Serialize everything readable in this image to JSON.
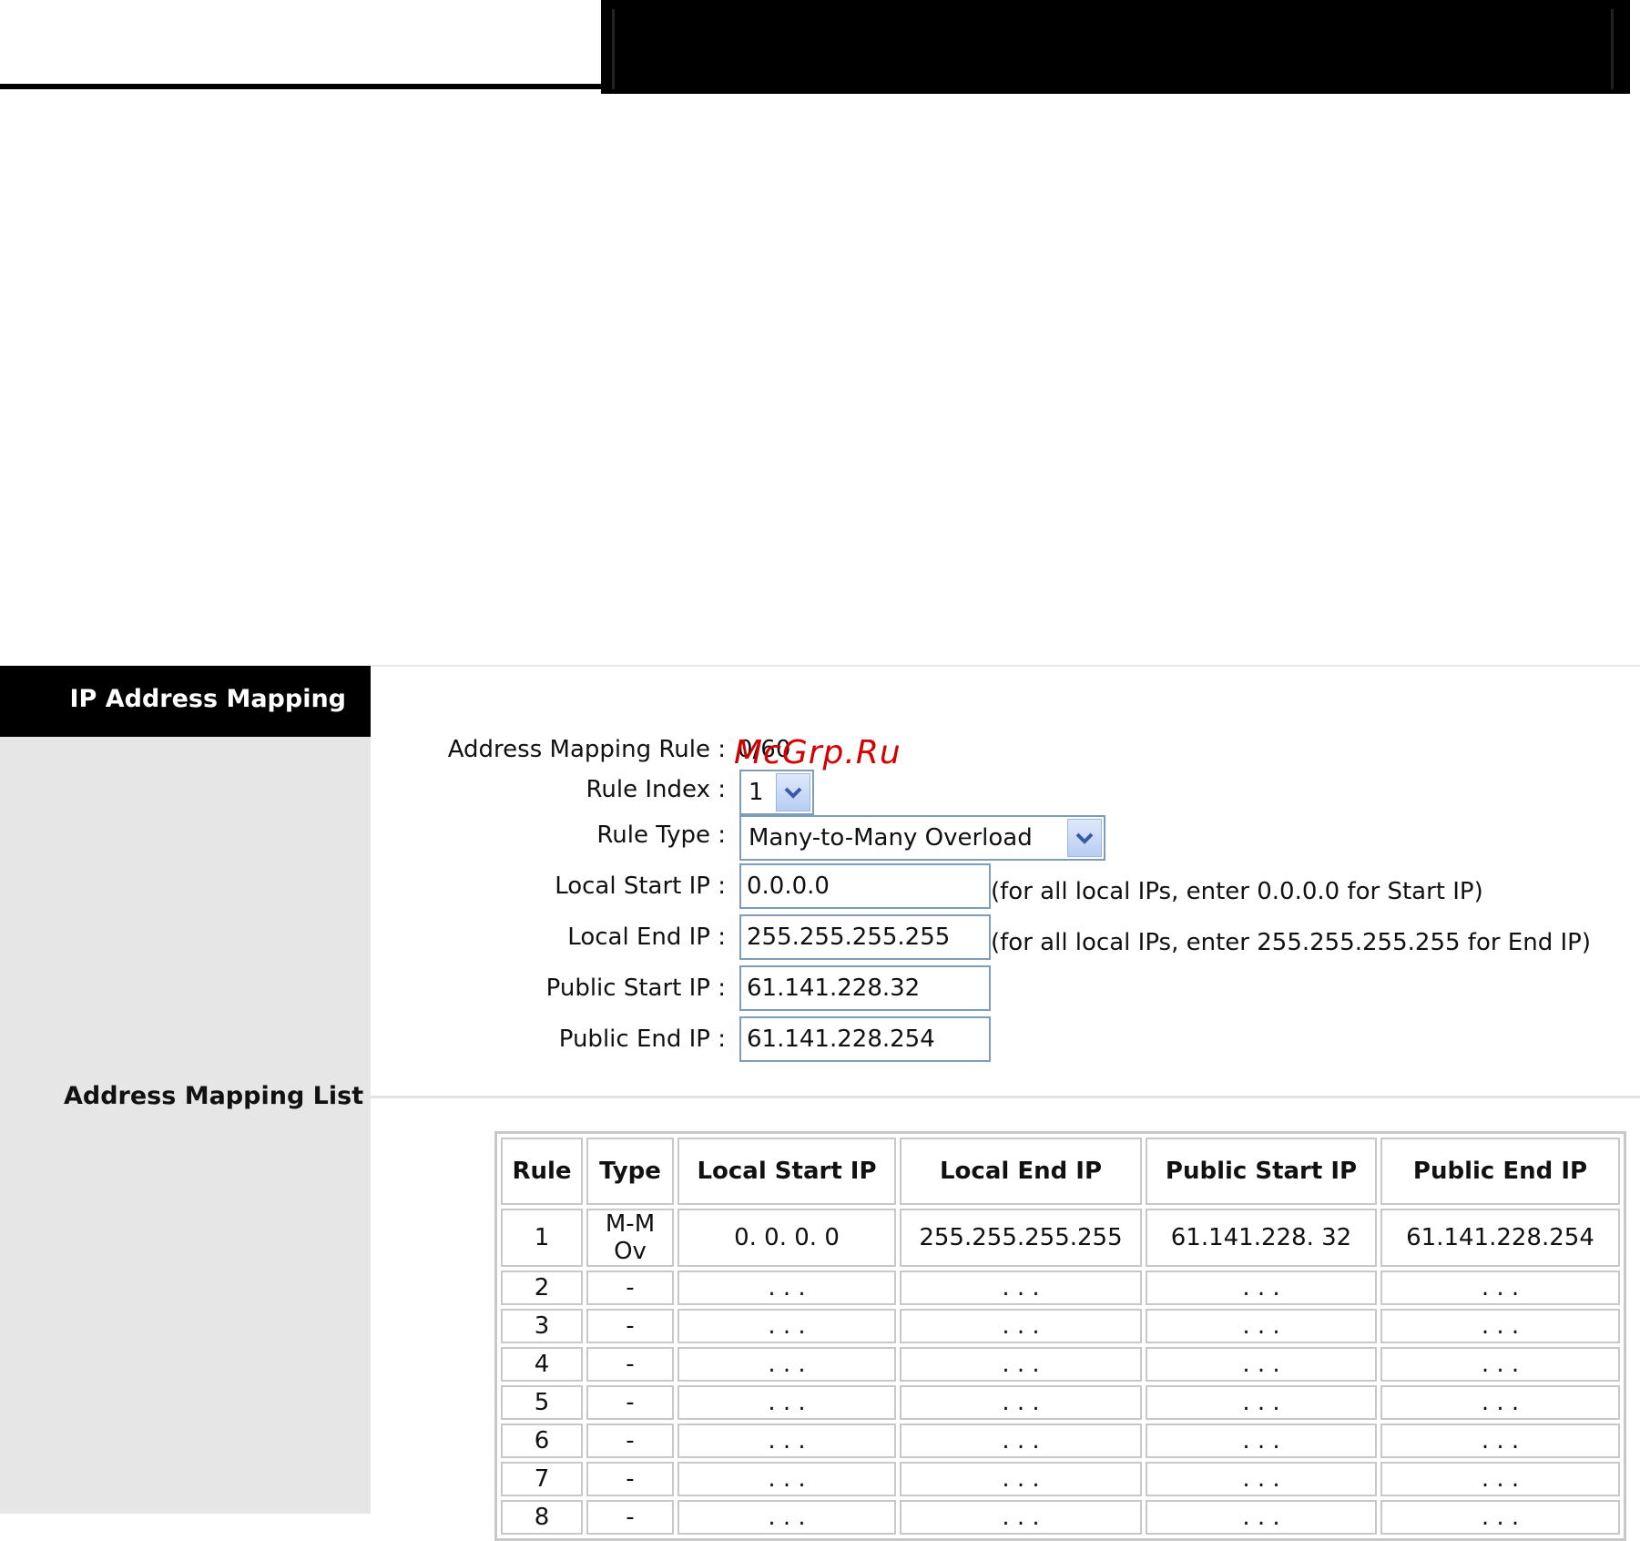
{
  "sidebar": {
    "title": "IP Address Mapping",
    "list_section": "Address Mapping List"
  },
  "form": {
    "address_mapping_rule_label": "Address Mapping Rule :",
    "address_mapping_rule_value": "0/60",
    "rule_index_label": "Rule Index :",
    "rule_index_value": "1",
    "rule_type_label": "Rule Type :",
    "rule_type_value": "Many-to-Many Overload",
    "local_start_ip_label": "Local Start IP :",
    "local_start_ip_value": "0.0.0.0",
    "local_start_ip_hint": "(for all local IPs, enter 0.0.0.0 for Start IP)",
    "local_end_ip_label": "Local End IP :",
    "local_end_ip_value": "255.255.255.255",
    "local_end_ip_hint": "(for all local IPs, enter 255.255.255.255 for End IP)",
    "public_start_ip_label": "Public Start IP :",
    "public_start_ip_value": "61.141.228.32",
    "public_end_ip_label": "Public End IP :",
    "public_end_ip_value": "61.141.228.254"
  },
  "watermark": "McGrp.Ru",
  "table": {
    "headers": [
      "Rule",
      "Type",
      "Local Start IP",
      "Local End IP",
      "Public Start IP",
      "Public End IP"
    ],
    "rows": [
      [
        "1",
        "M-M Ov",
        "0. 0. 0. 0",
        "255.255.255.255",
        "61.141.228. 32",
        "61.141.228.254"
      ],
      [
        "2",
        "-",
        ". . .",
        ". . .",
        ". . .",
        ". . ."
      ],
      [
        "3",
        "-",
        ". . .",
        ". . .",
        ". . .",
        ". . ."
      ],
      [
        "4",
        "-",
        ". . .",
        ". . .",
        ". . .",
        ". . ."
      ],
      [
        "5",
        "-",
        ". . .",
        ". . .",
        ". . .",
        ". . ."
      ],
      [
        "6",
        "-",
        ". . .",
        ". . .",
        ". . .",
        ". . ."
      ],
      [
        "7",
        "-",
        ". . .",
        ". . .",
        ". . .",
        ". . ."
      ],
      [
        "8",
        "-",
        ". . .",
        ". . .",
        ". . .",
        ". . ."
      ]
    ]
  },
  "colors": {
    "field_border": "#7f9db9",
    "panel_bg": "#e6e6e6",
    "watermark": "#d40000"
  }
}
